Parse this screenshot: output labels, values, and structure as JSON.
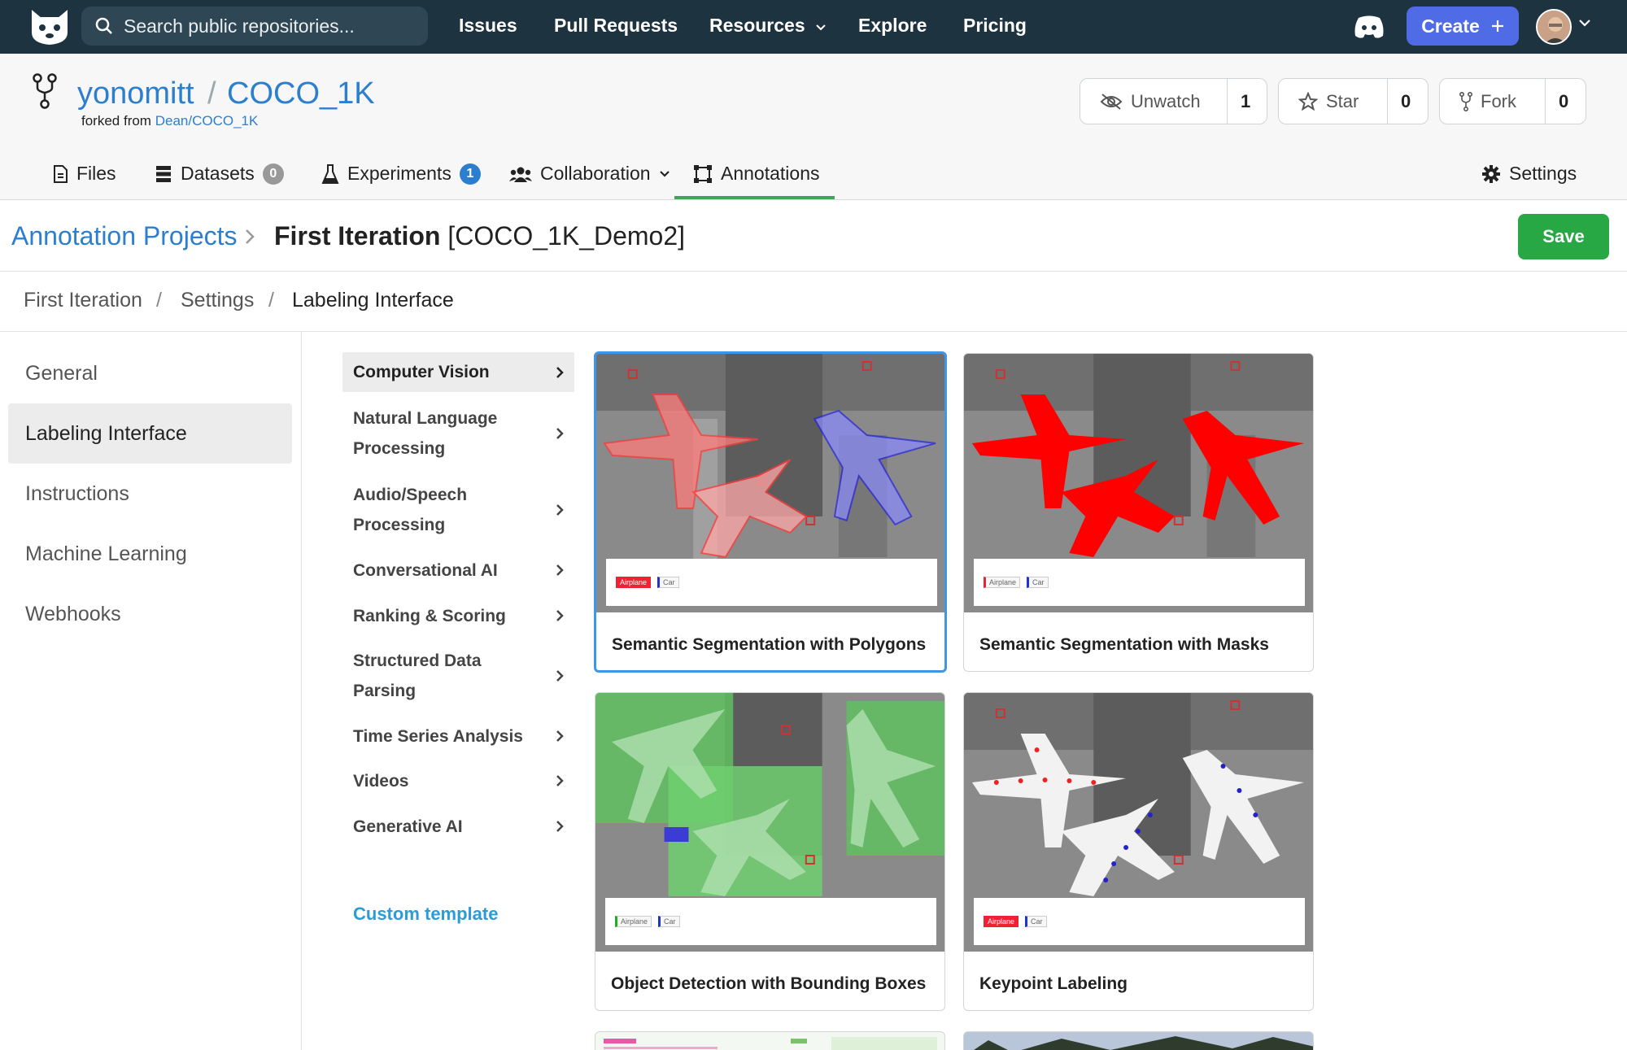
{
  "nav": {
    "search_placeholder": "Search public repositories...",
    "links": [
      "Issues",
      "Pull Requests",
      "Resources",
      "Explore",
      "Pricing"
    ],
    "create_label": "Create"
  },
  "repo": {
    "owner": "yonomitt",
    "separator": "/",
    "name": "COCO_1K",
    "forked_prefix": "forked from",
    "forked_from": "Dean/COCO_1K",
    "unwatch_label": "Unwatch",
    "unwatch_count": "1",
    "star_label": "Star",
    "star_count": "0",
    "fork_label": "Fork",
    "fork_count": "0"
  },
  "tabs": {
    "files": "Files",
    "datasets": "Datasets",
    "datasets_count": "0",
    "experiments": "Experiments",
    "experiments_count": "1",
    "collaboration": "Collaboration",
    "annotations": "Annotations",
    "settings": "Settings"
  },
  "header": {
    "parent": "Annotation Projects",
    "title_bold": "First Iteration",
    "title_rest": " [COCO_1K_Demo2]",
    "save_label": "Save"
  },
  "breadcrumb": [
    "First Iteration",
    "/",
    "Settings",
    "/",
    "Labeling Interface"
  ],
  "sidebar": [
    "General",
    "Labeling Interface",
    "Instructions",
    "Machine Learning",
    "Webhooks"
  ],
  "categories": [
    "Computer Vision",
    "Natural Language Processing",
    "Audio/Speech Processing",
    "Conversational AI",
    "Ranking & Scoring",
    "Structured Data Parsing",
    "Time Series Analysis",
    "Videos",
    "Generative AI"
  ],
  "custom_template": "Custom template",
  "templates": [
    {
      "title": "Semantic Segmentation with Polygons",
      "label_a": "Airplane",
      "label_b": "Car"
    },
    {
      "title": "Semantic Segmentation with Masks",
      "label_a": "Airplane",
      "label_b": "Car"
    },
    {
      "title": "Object Detection with Bounding Boxes",
      "label_a": "Airplane",
      "label_b": "Car"
    },
    {
      "title": "Keypoint Labeling",
      "label_a": "Airplane",
      "label_b": "Car"
    }
  ],
  "colors": {
    "nav_bg": "#1d3340",
    "accent_blue": "#2c7ecf",
    "create_bg": "#4f6be6",
    "save_green": "#28a745"
  }
}
